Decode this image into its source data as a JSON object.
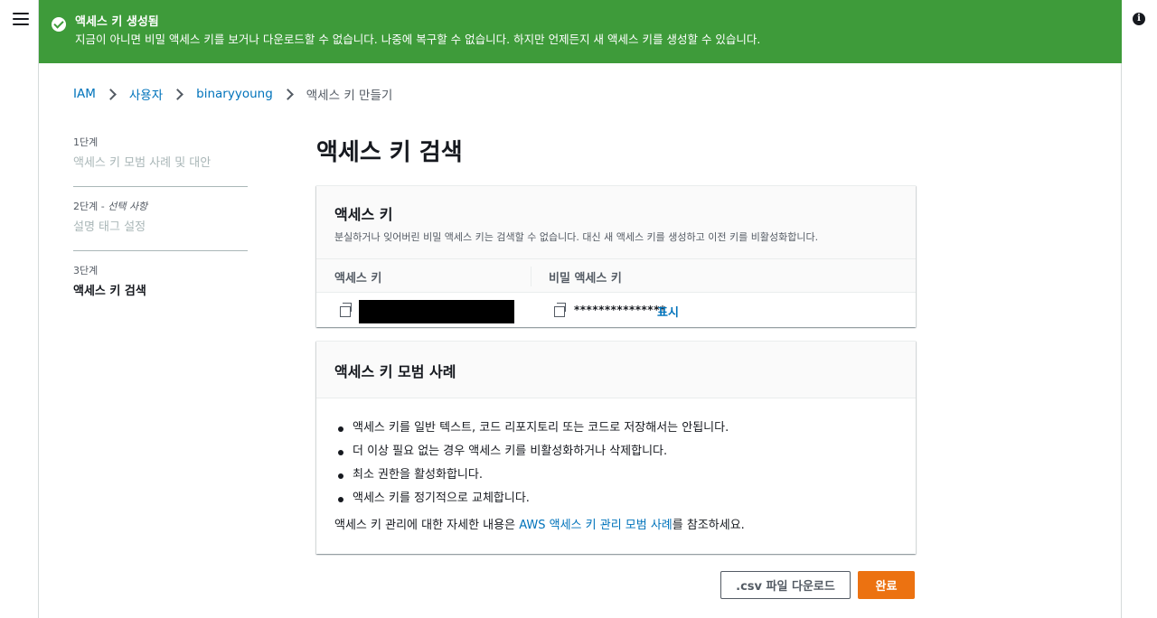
{
  "flash": {
    "title": "액세스 키 생성됨",
    "description": "지금이 아니면 비밀 액세스 키를 보거나 다운로드할 수 없습니다. 나중에 복구할 수 없습니다. 하지만 언제든지 새 액세스 키를 생성할 수 있습니다.",
    "color": "#3e9b3a"
  },
  "breadcrumb": [
    "IAM",
    "사용자",
    "binaryyoung",
    "액세스 키 만들기"
  ],
  "steps": [
    {
      "number": "1단계",
      "optional": "",
      "title": "액세스 키 모범 사례 및 대안"
    },
    {
      "number": "2단계 - ",
      "optional": "선택 사항",
      "title": "설명 태그 설정"
    },
    {
      "number": "3단계",
      "optional": "",
      "title": "액세스 키 검색"
    }
  ],
  "page_title": "액세스 키 검색",
  "keys_panel": {
    "title": "액세스 키",
    "subtitle": "분실하거나 잊어버린 비밀 액세스 키는 검색할 수 없습니다. 대신 새 액세스 키를 생성하고 이전 키를 비활성화합니다.",
    "col_access_key": "액세스 키",
    "col_secret_key": "비밀 액세스 키",
    "secret_masked": "***************",
    "show_label": "표시"
  },
  "best_panel": {
    "title": "액세스 키 모범 사례",
    "items": [
      "액세스 키를 일반 텍스트, 코드 리포지토리 또는 코드로 저장해서는 안됩니다.",
      "더 이상 필요 없는 경우 액세스 키를 비활성화하거나 삭제합니다.",
      "최소 권한을 활성화합니다.",
      "액세스 키를 정기적으로 교체합니다."
    ],
    "note_prefix": "액세스 키 관리에 대한 자세한 내용은 ",
    "note_link": "AWS 액세스 키 관리 모범 사례",
    "note_suffix": "를 참조하세요."
  },
  "buttons": {
    "download_csv": ".csv 파일 다운로드",
    "done": "완료"
  },
  "colors": {
    "link": "#0073bb",
    "primary": "#ec7211"
  }
}
